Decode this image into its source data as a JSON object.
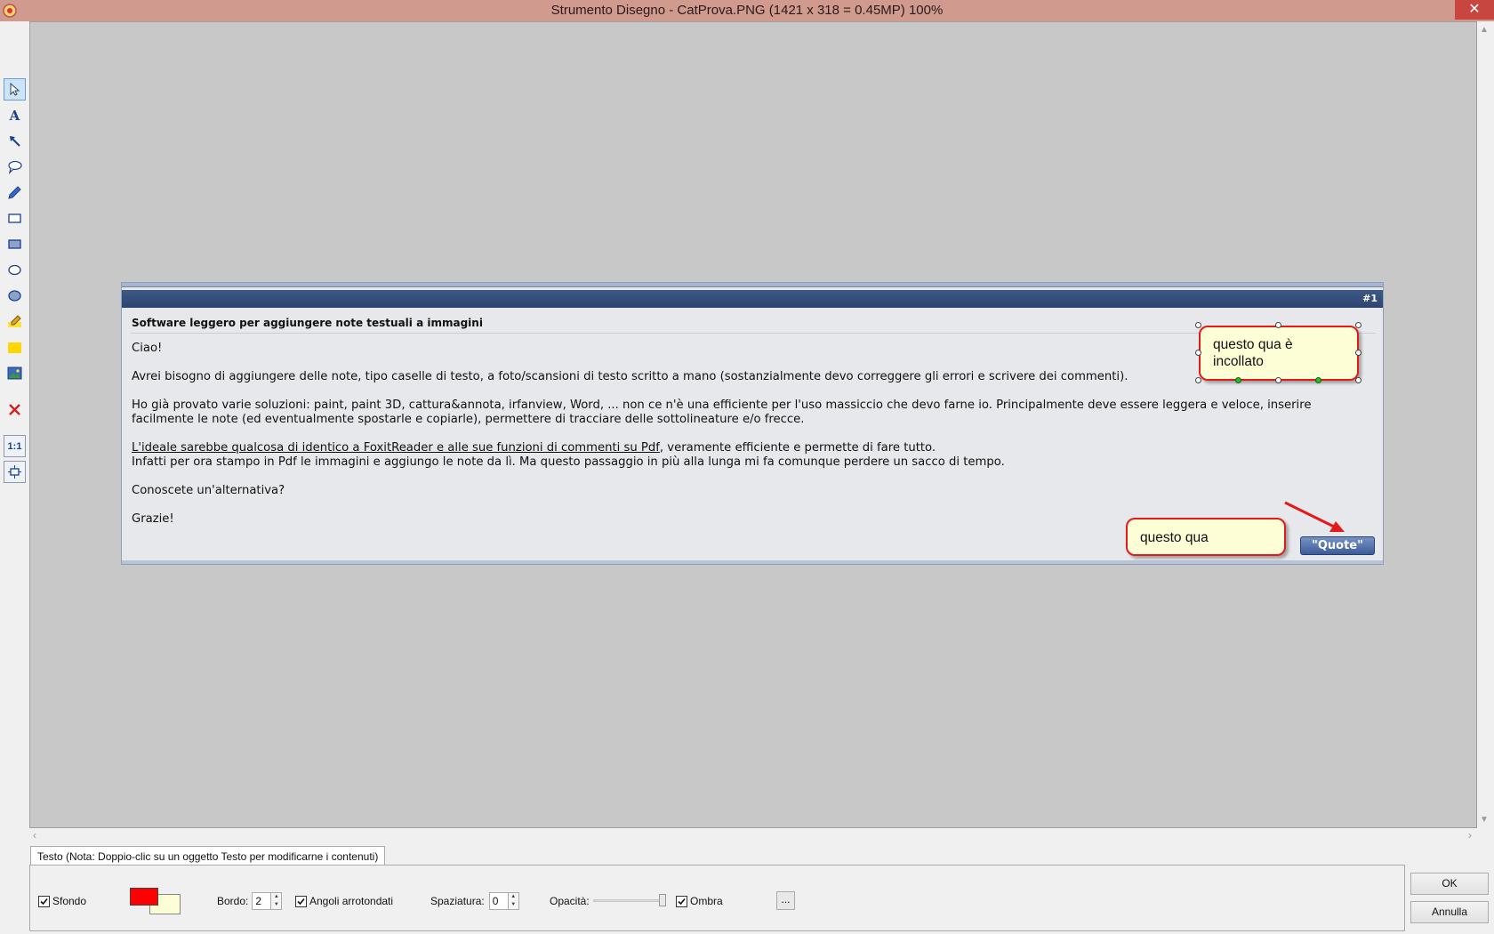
{
  "window": {
    "title": "Strumento Disegno  -  CatProva.PNG  (1421 x 318 = 0.45MP)    100%",
    "close_glyph": "✕"
  },
  "toolbar": {
    "tools": [
      {
        "name": "select-tool",
        "icon": "pointer-icon",
        "active": true
      },
      {
        "name": "text-tool",
        "icon": "text-a-icon",
        "label": "A"
      },
      {
        "name": "arrow-tool",
        "icon": "arrow-icon"
      },
      {
        "name": "callout-tool",
        "icon": "speech-bubble-icon"
      },
      {
        "name": "pen-tool",
        "icon": "pen-icon"
      },
      {
        "name": "rectangle-tool",
        "icon": "rectangle-icon"
      },
      {
        "name": "filled-rectangle-tool",
        "icon": "filled-rectangle-icon"
      },
      {
        "name": "ellipse-tool",
        "icon": "ellipse-icon"
      },
      {
        "name": "filled-ellipse-tool",
        "icon": "filled-ellipse-icon"
      },
      {
        "name": "highlighter-tool",
        "icon": "highlighter-icon"
      },
      {
        "name": "highlight-rect-tool",
        "icon": "yellow-rect-icon"
      },
      {
        "name": "image-tool",
        "icon": "image-icon"
      },
      {
        "name": "delete-tool",
        "icon": "delete-x-icon"
      },
      {
        "name": "actual-size-tool",
        "icon": "one-to-one-icon",
        "label": "1:1"
      },
      {
        "name": "fit-tool",
        "icon": "fit-to-window-icon"
      }
    ]
  },
  "post": {
    "number": "#1",
    "title": "Software leggero per aggiungere note testuali a immagini",
    "paragraphs": {
      "p1": "Ciao!",
      "p2": "Avrei bisogno di aggiungere delle note, tipo caselle di testo, a foto/scansioni di testo scritto a mano (sostanzialmente devo correggere gli errori e scrivere dei commenti).",
      "p3": "Ho già provato varie soluzioni: paint, paint 3D, cattura&annota, irfanview, Word, ... non ce n'è una efficiente per l'uso massiccio che devo farne io. Principalmente deve essere leggera e veloce, inserire facilmente le note (ed eventualmente spostarle e copiarle), permettere di tracciare delle sottolineature e/o frecce.",
      "p4_link": "L'ideale sarebbe qualcosa di identico a FoxitReader e alle sue funzioni di commenti su Pdf",
      "p4_rest": ", veramente efficiente e permette di fare tutto.",
      "p4_line2": "Infatti per ora stampo in Pdf le immagini e aggiungo le note da lì. Ma questo passaggio in più alla lunga mi fa comunque perdere un sacco di tempo.",
      "p5": "Conoscete un'alternativa?",
      "p6": "Grazie!"
    },
    "quote_button": "\"Quote\""
  },
  "annotations": {
    "callout_pasted": "questo qua è incollato",
    "callout_main": "questo qua",
    "fill_color": "#fefed6",
    "border_color": "#e41a1a"
  },
  "panel": {
    "tab_label": "Testo (Nota: Doppio-clic su un oggetto Testo per modificarne i contenuti)",
    "background": {
      "label": "Sfondo",
      "checked": true
    },
    "foreground_color": "#ff0000",
    "background_color": "#fefed6",
    "border": {
      "label": "Bordo:",
      "value": "2"
    },
    "rounded": {
      "label": "Angoli arrotondati",
      "checked": true
    },
    "spacing": {
      "label": "Spaziatura:",
      "value": "0"
    },
    "opacity": {
      "label": "Opacità:",
      "value": 1.0
    },
    "shadow": {
      "label": "Ombra",
      "checked": true
    },
    "more_label": "...",
    "ok_label": "OK",
    "cancel_label": "Annulla"
  }
}
